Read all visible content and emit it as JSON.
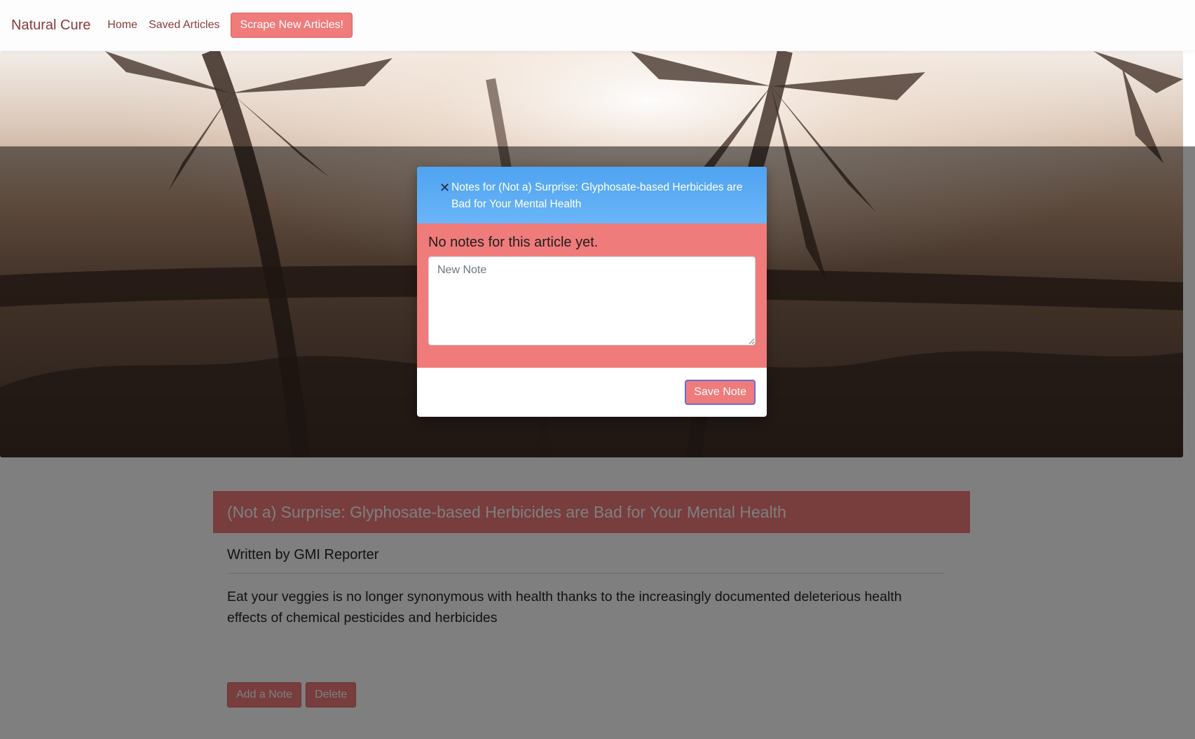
{
  "navbar": {
    "brand": "Natural Cure",
    "links": [
      "Home",
      "Saved Articles"
    ],
    "scrape_label": "Scrape New Articles!"
  },
  "article": {
    "title": "(Not a) Surprise: Glyphosate-based Herbicides are Bad for Your Mental Health",
    "author": "Written by GMI Reporter",
    "summary": "Eat your veggies is no longer synonymous with health thanks to the increasingly documented deleterious health effects of chemical pesticides and herbicides",
    "add_note_label": "Add a Note",
    "delete_label": "Delete"
  },
  "modal": {
    "close_icon": "close-icon",
    "title": "Notes for (Not a) Surprise: Glyphosate-based Herbicides are Bad for Your Mental Health",
    "empty_text": "No notes for this article yet.",
    "note_placeholder": "New Note",
    "save_label": "Save Note"
  },
  "colors": {
    "accent": "#f07b7b",
    "modal_header": "#5aa9f3",
    "brand_text": "#8a3b3b"
  }
}
